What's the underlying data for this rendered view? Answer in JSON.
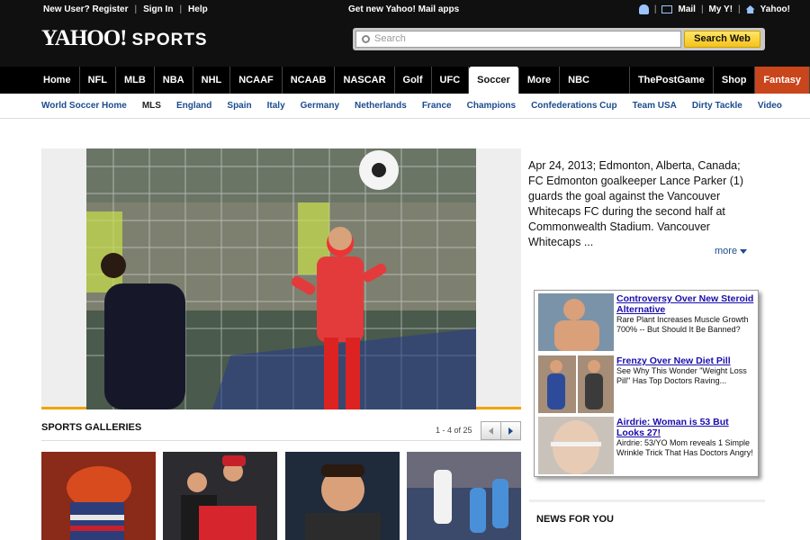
{
  "header": {
    "new_user": "New User?",
    "register": "Register",
    "sign_in": "Sign In",
    "help": "Help",
    "mail_apps": "Get new Yahoo! Mail apps",
    "mail": "Mail",
    "my_y": "My Y!",
    "yahoo": "Yahoo!",
    "logo_yahoo": "YAHOO!",
    "logo_sports": "SPORTS",
    "search_placeholder": "Search",
    "search_button": "Search Web"
  },
  "nav": {
    "items": [
      "Home",
      "NFL",
      "MLB",
      "NBA",
      "NHL",
      "NCAAF",
      "NCAAB",
      "NASCAR",
      "Golf",
      "UFC",
      "Soccer",
      "More",
      "NBC Sports",
      "ThePostGame",
      "Shop",
      "Fantasy"
    ],
    "active": "Soccer"
  },
  "subnav": {
    "items": [
      "World Soccer Home",
      "MLS",
      "England",
      "Spain",
      "Italy",
      "Germany",
      "Netherlands",
      "France",
      "Champions",
      "Confederations Cup",
      "Team USA",
      "Dirty Tackle",
      "Video"
    ],
    "active": "MLS"
  },
  "hero": {
    "caption": "Apr 24, 2013; Edmonton, Alberta, Canada; FC Edmonton goalkeeper Lance Parker (1) guards the goal against the Vancouver Whitecaps FC during the second half at Commonwealth Stadium. Vancouver Whitecaps ...",
    "more": "more"
  },
  "ads": [
    {
      "title": "Controversy Over New Steroid Alternative",
      "body": "Rare Plant Increases Muscle Growth 700% -- But Should It Be Banned?"
    },
    {
      "title": "Frenzy Over New Diet Pill",
      "body": "See Why This Wonder \"Weight Loss Pill\" Has Top Doctors Raving..."
    },
    {
      "title": "Airdrie: Woman is 53 But Looks 27!",
      "body": "Airdrie: 53/YO Mom reveals 1 Simple Wrinkle Trick That Has Doctors Angry!"
    }
  ],
  "galleries": {
    "title": "SPORTS GALLERIES",
    "count": "1 - 4 of 25"
  },
  "news": {
    "title": "NEWS FOR YOU"
  },
  "colors": {
    "header_bg": "#101010",
    "link_blue": "#1b4c8e",
    "fantasy": "#c9451b",
    "accent_gold": "#f0a400"
  }
}
